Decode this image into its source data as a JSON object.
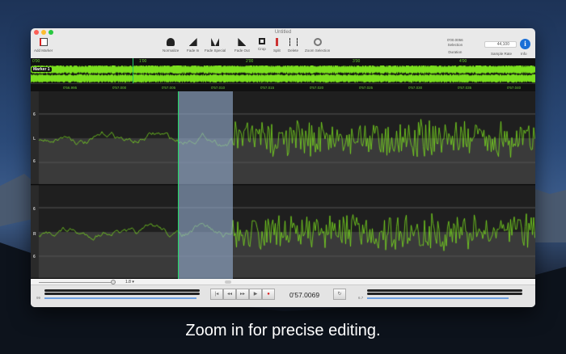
{
  "window": {
    "title": "Untitled"
  },
  "toolbar": {
    "add_marker": "Add Marker",
    "items": [
      "Normalize",
      "Fade In",
      "Fade Special",
      "Fade Out",
      "Crop",
      "Split",
      "Delete",
      "Zoom Selection"
    ],
    "selection_value": "0'00.0056",
    "selection_label": "Selection",
    "duration_label": "Duration",
    "sample_rate": "44,100",
    "sample_rate_label": "Sample Rate",
    "info_label": "Info"
  },
  "overview": {
    "ticks": [
      "0'00",
      "1'00",
      "2'00",
      "3'00",
      "4'00"
    ],
    "marker": "Marker 1"
  },
  "fine_ruler": {
    "ticks": [
      "0'56.995",
      "0'57.000",
      "0'57.005",
      "0'57.010",
      "0'57.015",
      "0'57.020",
      "0'57.025",
      "0'57.030",
      "0'57.035",
      "0'57.040"
    ]
  },
  "channels": [
    {
      "name": "L",
      "top": "6",
      "bottom": "6"
    },
    {
      "name": "R",
      "top": "6",
      "bottom": "6"
    }
  ],
  "zoom": {
    "value": "1.8"
  },
  "transport": {
    "time": "0'57.0069",
    "input_level": "99",
    "output_level": "6.7"
  },
  "colors": {
    "waveform": "#7be01e",
    "selection": "#8fa8c8"
  },
  "caption": "Zoom in for precise editing."
}
